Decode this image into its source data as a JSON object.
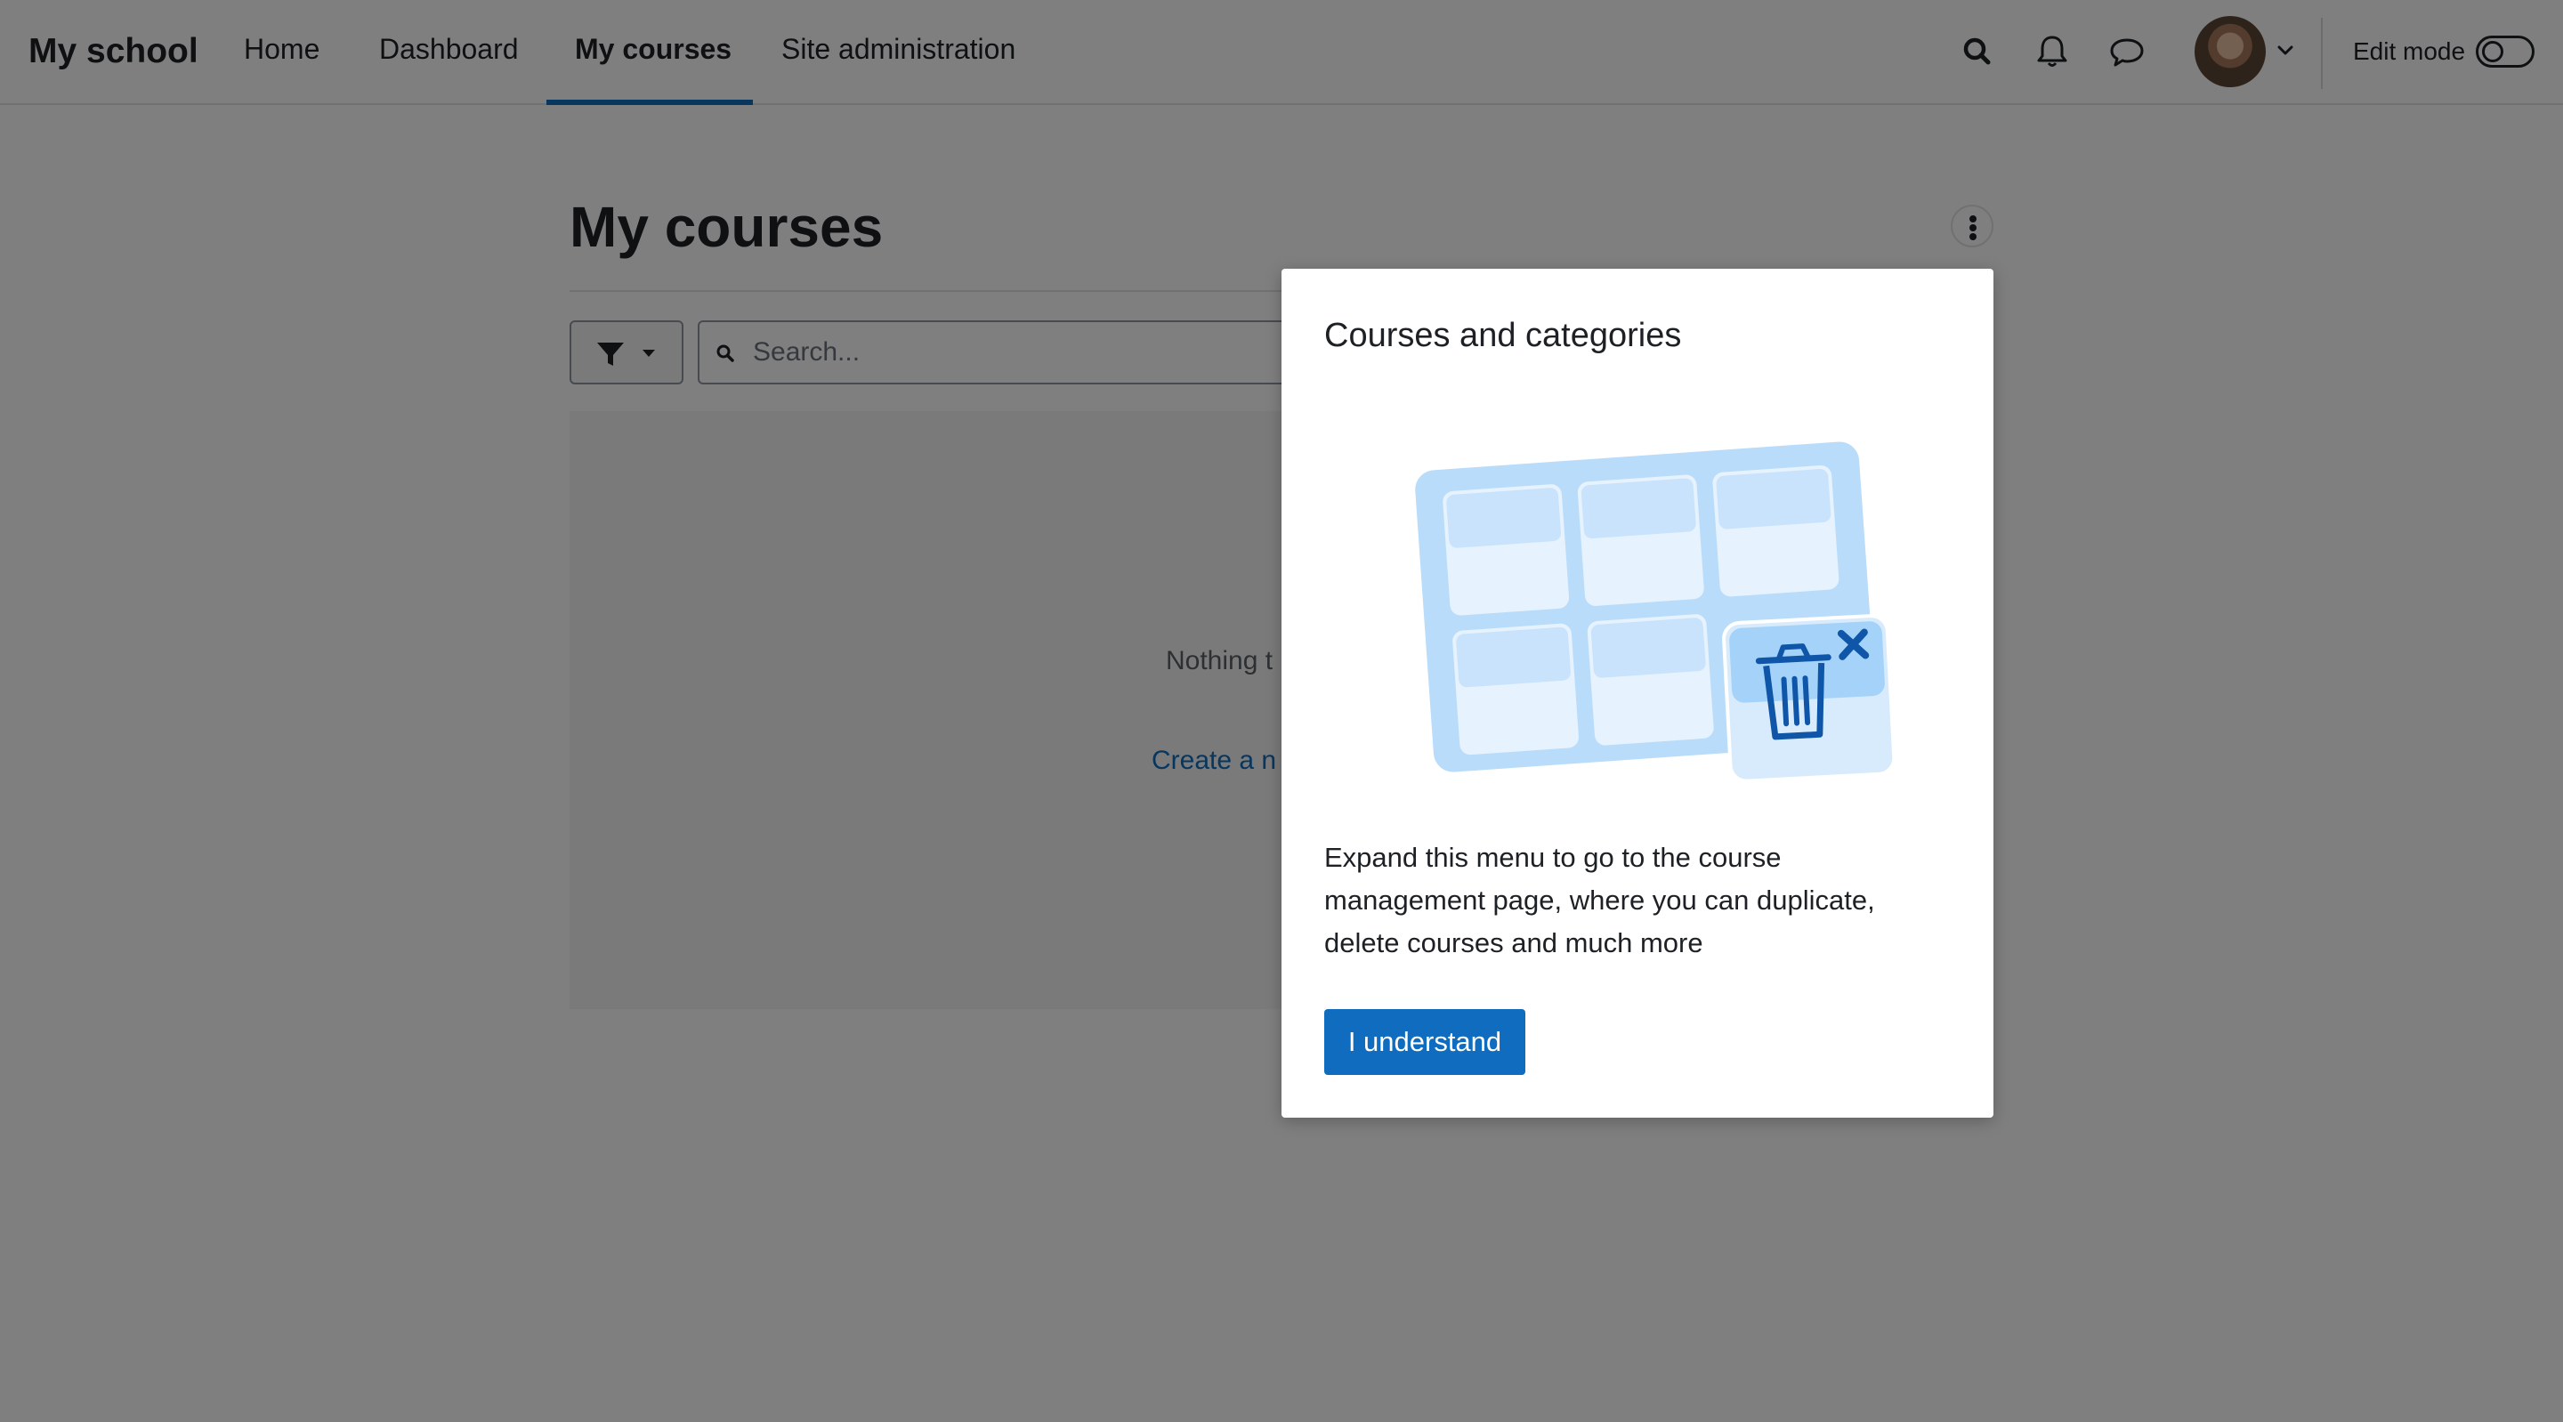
{
  "navbar": {
    "brand": "My school",
    "items": [
      {
        "label": "Home"
      },
      {
        "label": "Dashboard"
      },
      {
        "label": "My courses",
        "active": true
      },
      {
        "label": "Site administration"
      }
    ],
    "icons": [
      "search-icon",
      "bell-icon",
      "message-icon",
      "chevron-down-icon"
    ],
    "edit_mode_label": "Edit mode",
    "edit_mode_on": false
  },
  "page": {
    "title": "My courses",
    "search_placeholder": "Search...",
    "empty_text": "Nothing t",
    "create_link": "Create a n"
  },
  "popover": {
    "title": "Courses and categories",
    "body_lines": [
      "Expand this menu to go to the course",
      "management page, where you can duplicate,",
      "delete courses and much more"
    ],
    "button_label": "I understand"
  },
  "colors": {
    "accent": "#0f6cbf",
    "backdrop": "rgba(0,0,0,0.5)",
    "illustration_light": "#cfe6fb",
    "illustration_mid": "#b9dcfa",
    "illustration_dark": "#0f55a8"
  }
}
